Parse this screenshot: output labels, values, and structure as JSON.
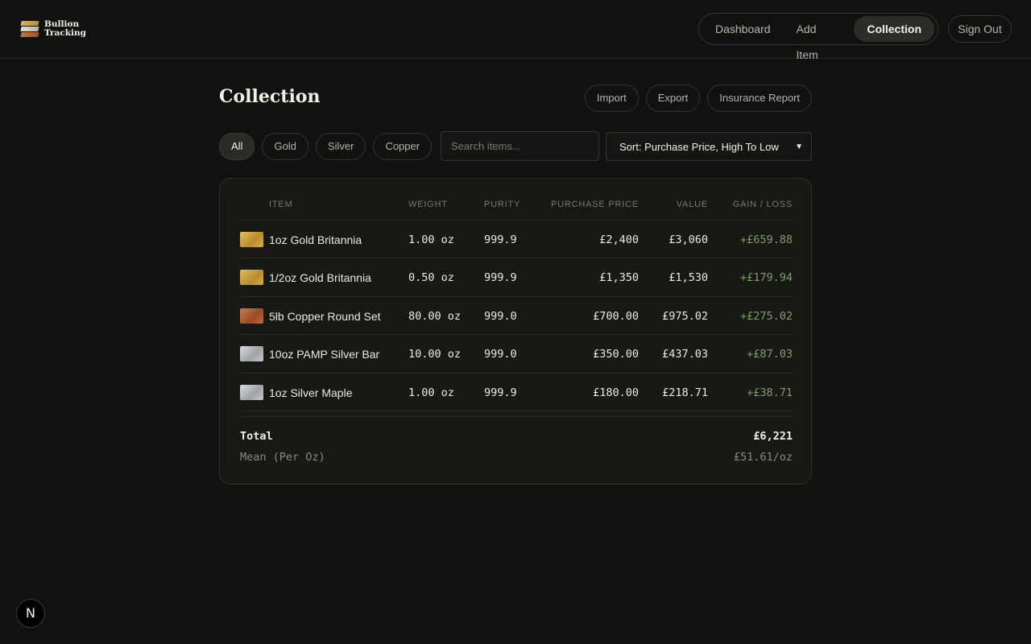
{
  "brand": {
    "line1": "Bullion",
    "line2": "Tracking"
  },
  "nav": {
    "items": [
      "Dashboard",
      "Add Item",
      "Collection"
    ],
    "active": "Collection",
    "sign_out": "Sign Out"
  },
  "page": {
    "title": "Collection"
  },
  "actions": {
    "import": "Import",
    "export": "Export",
    "insurance": "Insurance Report"
  },
  "filters": {
    "items": [
      "All",
      "Gold",
      "Silver",
      "Copper"
    ],
    "active": "All"
  },
  "search": {
    "placeholder": "Search items...",
    "value": ""
  },
  "sort": {
    "selected": "Sort: Purchase Price, High To Low"
  },
  "table": {
    "headers": [
      "ITEM",
      "WEIGHT",
      "PURITY",
      "PURCHASE PRICE",
      "VALUE",
      "GAIN / LOSS"
    ],
    "rows": [
      {
        "metal": "gold",
        "name": "1oz Gold Britannia",
        "weight": "1.00 oz",
        "purity": "999.9",
        "purchase": "£2,400",
        "value": "£3,060",
        "gain": "+£659.88"
      },
      {
        "metal": "gold",
        "name": "1/2oz Gold Britannia",
        "weight": "0.50 oz",
        "purity": "999.9",
        "purchase": "£1,350",
        "value": "£1,530",
        "gain": "+£179.94"
      },
      {
        "metal": "copper",
        "name": "5lb Copper Round Set",
        "weight": "80.00 oz",
        "purity": "999.0",
        "purchase": "£700.00",
        "value": "£975.02",
        "gain": "+£275.02"
      },
      {
        "metal": "silver",
        "name": "10oz PAMP Silver Bar",
        "weight": "10.00 oz",
        "purity": "999.0",
        "purchase": "£350.00",
        "value": "£437.03",
        "gain": "+£87.03"
      },
      {
        "metal": "silver",
        "name": "1oz Silver Maple",
        "weight": "1.00 oz",
        "purity": "999.9",
        "purchase": "£180.00",
        "value": "£218.71",
        "gain": "+£38.71"
      }
    ],
    "total_label": "Total",
    "total_value": "£6,221",
    "mean_label": "Mean (Per Oz)",
    "mean_value": "£51.61/oz"
  },
  "colors": {
    "gold": "#c9a13f",
    "silver": "#b9bcbf",
    "copper": "#b8643a",
    "gain": "#7d9f64"
  },
  "badge": {
    "letter": "N"
  }
}
